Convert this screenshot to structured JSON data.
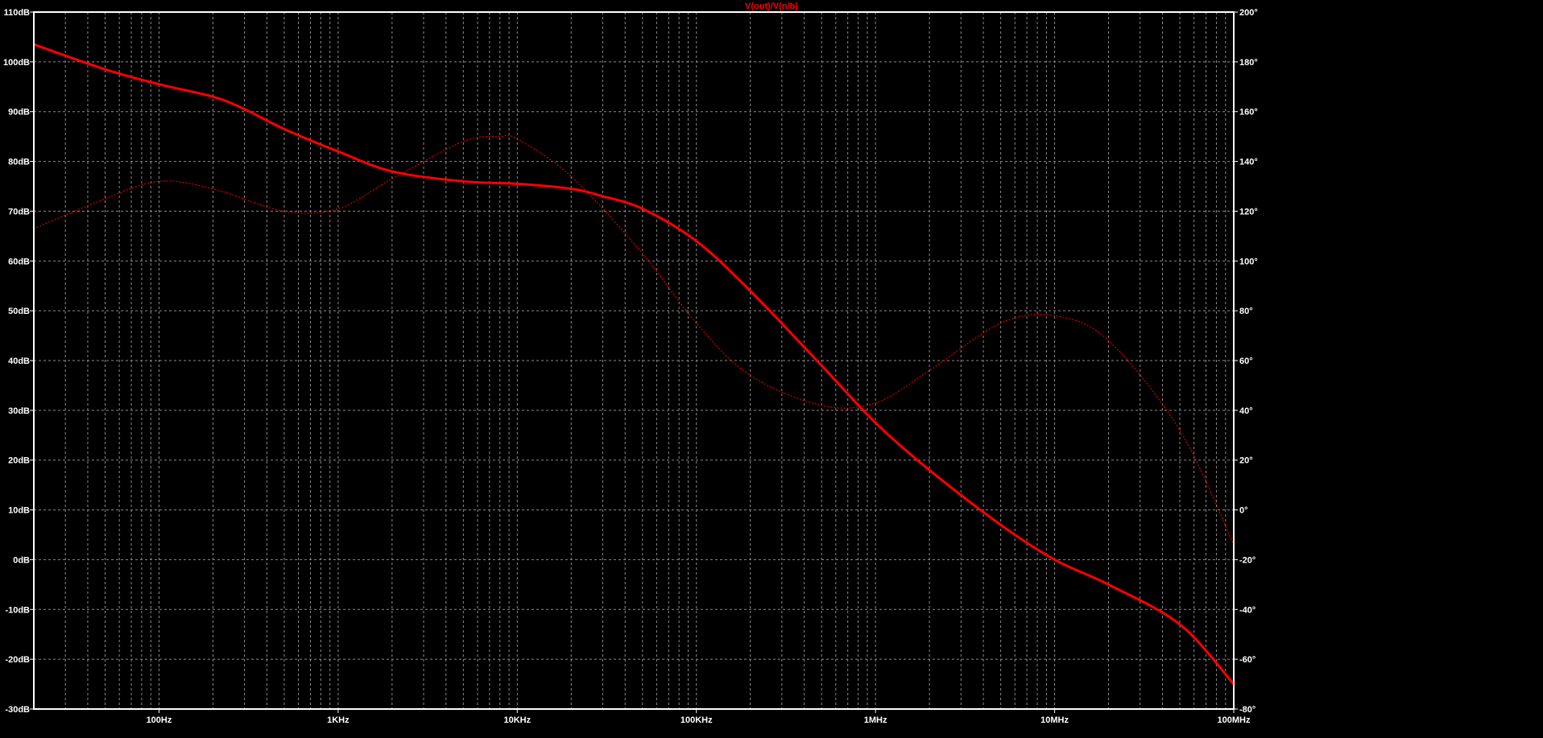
{
  "chart_data": {
    "type": "line",
    "title": "V(out)/V(n/b)",
    "xscale": "log",
    "xlim_hz": [
      20,
      100000000
    ],
    "x_ticks": [
      {
        "value": 100,
        "label": "100Hz"
      },
      {
        "value": 1000,
        "label": "1KHz"
      },
      {
        "value": 10000,
        "label": "10KHz"
      },
      {
        "value": 100000,
        "label": "100KHz"
      },
      {
        "value": 1000000,
        "label": "1MHz"
      },
      {
        "value": 10000000,
        "label": "10MHz"
      },
      {
        "value": 100000000,
        "label": "100MHz"
      }
    ],
    "y_left": {
      "lim": [
        -30,
        110
      ],
      "ticks": [
        {
          "value": 110,
          "label": "110dB"
        },
        {
          "value": 100,
          "label": "100dB"
        },
        {
          "value": 90,
          "label": "90dB"
        },
        {
          "value": 80,
          "label": "80dB"
        },
        {
          "value": 70,
          "label": "70dB"
        },
        {
          "value": 60,
          "label": "60dB"
        },
        {
          "value": 50,
          "label": "50dB"
        },
        {
          "value": 40,
          "label": "40dB"
        },
        {
          "value": 30,
          "label": "30dB"
        },
        {
          "value": 20,
          "label": "20dB"
        },
        {
          "value": 10,
          "label": "10dB"
        },
        {
          "value": 0,
          "label": "0dB"
        },
        {
          "value": -10,
          "label": "-10dB"
        },
        {
          "value": -20,
          "label": "-20dB"
        },
        {
          "value": -30,
          "label": "-30dB"
        }
      ]
    },
    "y_right": {
      "lim": [
        -80,
        200
      ],
      "ticks": [
        {
          "value": 200,
          "label": "200°"
        },
        {
          "value": 180,
          "label": "180°"
        },
        {
          "value": 160,
          "label": "160°"
        },
        {
          "value": 140,
          "label": "140°"
        },
        {
          "value": 120,
          "label": "120°"
        },
        {
          "value": 100,
          "label": "100°"
        },
        {
          "value": 80,
          "label": "80°"
        },
        {
          "value": 60,
          "label": "60°"
        },
        {
          "value": 40,
          "label": "40°"
        },
        {
          "value": 20,
          "label": "20°"
        },
        {
          "value": 0,
          "label": "0°"
        },
        {
          "value": -20,
          "label": "-20°"
        },
        {
          "value": -40,
          "label": "-40°"
        },
        {
          "value": -60,
          "label": "-60°"
        },
        {
          "value": -80,
          "label": "-80°"
        }
      ]
    },
    "grid": true,
    "series": [
      {
        "kind": "magnitude",
        "axis": "left",
        "style": "solid",
        "color": "#ff0000",
        "x": [
          20,
          50,
          100,
          200,
          300,
          500,
          1000,
          2000,
          5000,
          10000,
          20000,
          30000,
          50000,
          100000,
          200000,
          500000,
          1000000,
          2000000,
          5000000,
          10000000,
          20000000,
          50000000,
          100000000
        ],
        "y": [
          103.5,
          98.5,
          95.5,
          93,
          90.5,
          86.5,
          82,
          78,
          76,
          75.5,
          74.5,
          73,
          70.5,
          64,
          54,
          39,
          27.5,
          18,
          7,
          0,
          -5,
          -13,
          -25
        ]
      },
      {
        "kind": "phase",
        "axis": "right",
        "style": "dotted",
        "color": "#ff0000",
        "x": [
          20,
          50,
          100,
          200,
          500,
          1000,
          2000,
          5000,
          8000,
          10000,
          20000,
          50000,
          100000,
          200000,
          500000,
          1000000,
          2000000,
          5000000,
          10000000,
          20000000,
          50000000,
          100000000
        ],
        "y": [
          113,
          125,
          132,
          129,
          120,
          121,
          133,
          148,
          150,
          149,
          134,
          103,
          75,
          54,
          42,
          43,
          56,
          75,
          78,
          68,
          32,
          -14
        ]
      }
    ]
  }
}
